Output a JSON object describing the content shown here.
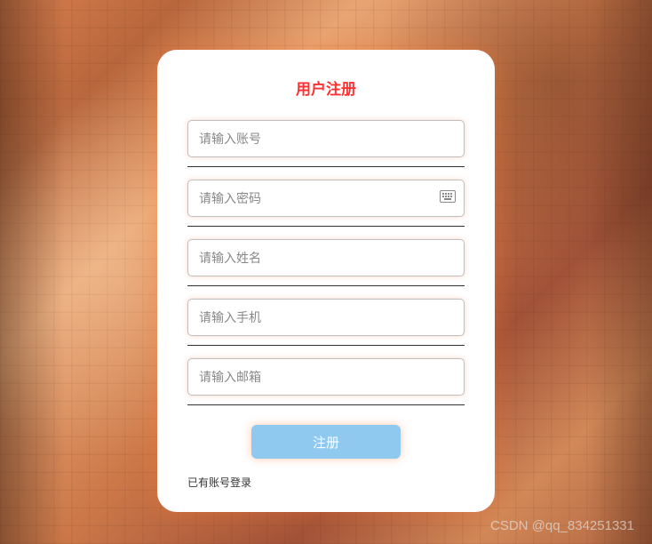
{
  "form": {
    "title": "用户注册",
    "fields": {
      "account": {
        "placeholder": "请输入账号"
      },
      "password": {
        "placeholder": "请输入密码"
      },
      "name": {
        "placeholder": "请输入姓名"
      },
      "phone": {
        "placeholder": "请输入手机"
      },
      "email": {
        "placeholder": "请输入邮箱"
      }
    },
    "submit_label": "注册",
    "login_link_text": "已有账号登录"
  },
  "watermark": "CSDN @qq_834251331"
}
